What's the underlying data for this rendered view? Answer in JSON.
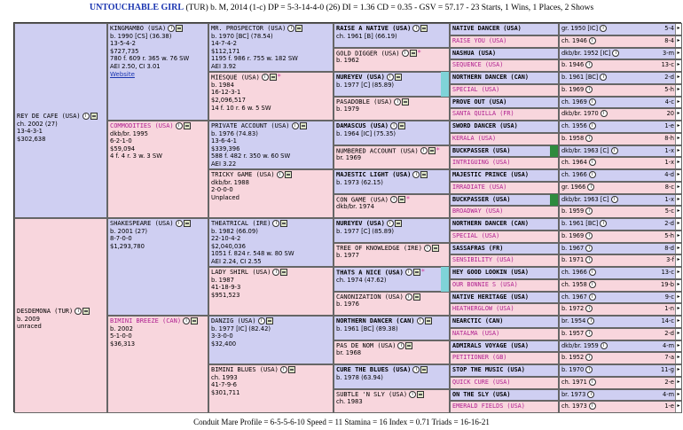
{
  "header": {
    "horse_name": "UNTOUCHABLE GIRL",
    "details": "(TUR) b. M, 2014 (1-c) DP = 5-3-14-4-0 (26) DI = 1.36   CD = 0.35 - GSV = 57.17 - 23 Starts, 1 Wins, 1 Places, 2 Shows"
  },
  "footer": "Conduit Mare Profile = 6-5-5-6-10   Speed = 11   Stamina = 16   Index = 0.71   Triads = 16-16-21",
  "gen1": [
    {
      "name": "REY DE CAFE (USA)",
      "lines": [
        "ch. 2002 (27)",
        "13-4-3-1",
        "$302,638"
      ]
    },
    {
      "name": "DESDEMONA (TUR)",
      "lines": [
        "b. 2009",
        "unraced"
      ]
    }
  ],
  "gen2": [
    {
      "name": "KINGMAMBO (USA)",
      "lines": [
        "b. 1990 [CS] (36.38)",
        "13-5-4-2",
        "$727,735",
        "780 f. 609 r. 365 w. 76 SW",
        "AEI 2.50, CI 3.01"
      ],
      "website": "Website"
    },
    {
      "name": "COMMODITIES (USA)",
      "lines": [
        "dkb/br. 1995",
        "6-2-1-0",
        "$59,094",
        "4 f. 4 r. 3 w. 3 SW"
      ]
    },
    {
      "name": "SHAKESPEARE (USA)",
      "lines": [
        "b. 2001 (27)",
        "8-7-0-0",
        "$1,293,780"
      ]
    },
    {
      "name": "BIMINI BREEZE (CAN)",
      "lines": [
        "b. 2002",
        "5-1-0-0",
        "$36,313"
      ]
    }
  ],
  "gen3": [
    {
      "name": "MR. PROSPECTOR (USA)",
      "lines": [
        "b. 1970 [BC] (78.54)",
        "14-7-4-2",
        "$112,171",
        "1195 f. 986 r. 755 w. 182 SW",
        "AEI 3.92"
      ]
    },
    {
      "name": "MIESQUE (USA)",
      "lines": [
        "b. 1984",
        "16-12-3-1",
        "$2,096,517",
        "14 f. 10 r. 6 w. 5 SW"
      ]
    },
    {
      "name": "PRIVATE ACCOUNT (USA)",
      "lines": [
        "b. 1976 (74.83)",
        "13-6-4-1",
        "$339,396",
        "588 f. 482 r. 350 w. 60 SW",
        "AEI 3.22"
      ]
    },
    {
      "name": "TRICKY GAME (USA)",
      "lines": [
        "dkb/br. 1988",
        "2-0-0-0",
        "Unplaced"
      ]
    },
    {
      "name": "THEATRICAL (IRE)",
      "lines": [
        "b. 1982 (66.09)",
        "22-10-4-2",
        "$2,040,036",
        "1051 f. 824 r. 548 w. 80 SW",
        "AEI 2.24, CI 2.55"
      ]
    },
    {
      "name": "LADY SHIRL (USA)",
      "lines": [
        "b. 1987",
        "41-18-9-3",
        "$951,523"
      ]
    },
    {
      "name": "DANZIG (USA)",
      "lines": [
        "b. 1977 [IC] (82.42)",
        "3-3-0-0",
        "$32,400"
      ]
    },
    {
      "name": "BIMINI BLUES (USA)",
      "lines": [
        "ch. 1993",
        "41-7-9-6",
        "$301,711"
      ]
    }
  ],
  "gen4": [
    {
      "name": "RAISE A NATIVE (USA)",
      "lines": [
        "ch. 1961 [B] (66.19)"
      ]
    },
    {
      "name": "GOLD DIGGER (USA)",
      "lines": [
        "b. 1962"
      ]
    },
    {
      "name": "NUREYEV (USA)",
      "lines": [
        "b. 1977 [C] (85.89)"
      ]
    },
    {
      "name": "PASADOBLE (USA)",
      "lines": [
        "b. 1979"
      ]
    },
    {
      "name": "DAMASCUS (USA)",
      "lines": [
        "b. 1964 [IC] (75.35)"
      ]
    },
    {
      "name": "NUMBERED ACCOUNT (USA)",
      "lines": [
        "br. 1969"
      ]
    },
    {
      "name": "MAJESTIC LIGHT (USA)",
      "lines": [
        "b. 1973 (62.15)"
      ]
    },
    {
      "name": "CON GAME (USA)",
      "lines": [
        "dkb/br. 1974"
      ]
    },
    {
      "name": "NUREYEV (USA)",
      "lines": [
        "b. 1977 [C] (85.89)"
      ]
    },
    {
      "name": "TREE OF KNOWLEDGE (IRE)",
      "lines": [
        "b. 1977"
      ]
    },
    {
      "name": "THATS A NICE (USA)",
      "lines": [
        "ch. 1974 (47.62)"
      ]
    },
    {
      "name": "CANONIZATION (USA)",
      "lines": [
        "b. 1976"
      ]
    },
    {
      "name": "NORTHERN DANCER (CAN)",
      "lines": [
        "b. 1961 [BC] (89.38)"
      ]
    },
    {
      "name": "PAS DE NOM (USA)",
      "lines": [
        "br. 1968"
      ]
    },
    {
      "name": "CURE THE BLUES (USA)",
      "lines": [
        "b. 1978 (63.94)"
      ]
    },
    {
      "name": "SUBTLE 'N SLY (USA)",
      "lines": [
        "ch. 1983"
      ]
    }
  ],
  "gen5": [
    {
      "name": "NATIVE DANCER (USA)",
      "info": "gr. 1950 [IC]",
      "num": "5-4"
    },
    {
      "name": "RAISE YOU (USA)",
      "info": "ch. 1946",
      "num": "8-4"
    },
    {
      "name": "NASHUA (USA)",
      "info": "dkb/br. 1952 [IC]",
      "num": "3-m"
    },
    {
      "name": "SEQUENCE (USA)",
      "info": "b. 1946",
      "num": "13-c"
    },
    {
      "name": "NORTHERN DANCER (CAN)",
      "info": "b. 1961 [BC]",
      "num": "2-d"
    },
    {
      "name": "SPECIAL (USA)",
      "info": "b. 1969",
      "num": "5-h"
    },
    {
      "name": "PROVE OUT (USA)",
      "info": "ch. 1969",
      "num": "4-c"
    },
    {
      "name": "SANTA QUILLA (FR)",
      "info": "dkb/br. 1970",
      "num": "20"
    },
    {
      "name": "SWORD DANCER (USA)",
      "info": "ch. 1956",
      "num": "1-e"
    },
    {
      "name": "KERALA (USA)",
      "info": "b. 1958",
      "num": "8-h"
    },
    {
      "name": "BUCKPASSER (USA)",
      "info": "dkb/br. 1963 [C]",
      "num": "1-x"
    },
    {
      "name": "INTRIGUING (USA)",
      "info": "ch. 1964",
      "num": "1-x"
    },
    {
      "name": "MAJESTIC PRINCE (USA)",
      "info": "ch. 1966",
      "num": "4-d"
    },
    {
      "name": "IRRADIATE (USA)",
      "info": "gr. 1966",
      "num": "8-c"
    },
    {
      "name": "BUCKPASSER (USA)",
      "info": "dkb/br. 1963 [C]",
      "num": "1-x"
    },
    {
      "name": "BROADWAY (USA)",
      "info": "b. 1959",
      "num": "5-c"
    },
    {
      "name": "NORTHERN DANCER (CAN)",
      "info": "b. 1961 [BC]",
      "num": "2-d"
    },
    {
      "name": "SPECIAL (USA)",
      "info": "b. 1969",
      "num": "5-h"
    },
    {
      "name": "SASSAFRAS (FR)",
      "info": "b. 1967",
      "num": "8-d"
    },
    {
      "name": "SENSIBILITY (USA)",
      "info": "b. 1971",
      "num": "3-f"
    },
    {
      "name": "HEY GOOD LOOKIN (USA)",
      "info": "ch. 1966",
      "num": "13-c"
    },
    {
      "name": "OUR BONNIE S (USA)",
      "info": "ch. 1958",
      "num": "19-b"
    },
    {
      "name": "NATIVE HERITAGE (USA)",
      "info": "ch. 1967",
      "num": "9-c"
    },
    {
      "name": "HEATHERGLOW (USA)",
      "info": "b. 1972",
      "num": "1-n"
    },
    {
      "name": "NEARCTIC (CAN)",
      "info": "br. 1954",
      "num": "14-c"
    },
    {
      "name": "NATALMA (USA)",
      "info": "b. 1957",
      "num": "2-d"
    },
    {
      "name": "ADMIRALS VOYAGE (USA)",
      "info": "dkb/br. 1959",
      "num": "4-m"
    },
    {
      "name": "PETITIONER (GB)",
      "info": "b. 1952",
      "num": "7-a"
    },
    {
      "name": "STOP THE MUSIC (USA)",
      "info": "b. 1970",
      "num": "11-g"
    },
    {
      "name": "QUICK CURE (USA)",
      "info": "ch. 1971",
      "num": "2-e"
    },
    {
      "name": "ON THE SLY (USA)",
      "info": "br. 1973",
      "num": "4-m"
    },
    {
      "name": "EMERALD FIELDS (USA)",
      "info": "ch. 1973",
      "num": "1-e"
    }
  ]
}
